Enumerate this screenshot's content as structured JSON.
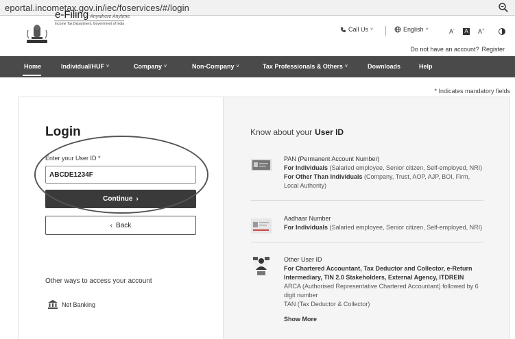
{
  "browser": {
    "url": "eportal.incometax.gov.in/iec/foservices/#/login",
    "zoom_icon": "zoom-icon"
  },
  "header": {
    "logo_title": "e-Filing",
    "logo_tagline": "Anywhere Anytime",
    "logo_subtitle": "Income Tax Department, Government of India",
    "call_us": "Call Us",
    "language": "English",
    "font_decrease": "A",
    "font_normal": "A",
    "font_increase": "A",
    "no_account_text": "Do not have an account?",
    "register": "Register"
  },
  "nav": {
    "items": [
      {
        "label": "Home"
      },
      {
        "label": "Individual/HUF"
      },
      {
        "label": "Company"
      },
      {
        "label": "Non-Company"
      },
      {
        "label": "Tax Professionals & Others"
      },
      {
        "label": "Downloads"
      },
      {
        "label": "Help"
      }
    ]
  },
  "mandatory_note": "* Indicates mandatory fields",
  "login": {
    "title": "Login",
    "field_label": "Enter your User ID *",
    "user_id_value": "ABCDE1234F",
    "continue": "Continue",
    "back": "Back",
    "other_ways": "Other ways to access your account",
    "net_banking": "Net Banking"
  },
  "know_panel": {
    "title_prefix": "Know about your",
    "title_bold": "User ID",
    "pan": {
      "head": "PAN (Permanent Account Number)",
      "ind_label": "For Individuals",
      "ind_text": " (Salaried employee, Senior citizen, Self-employed, NRI)",
      "other_label": "For Other Than Individuals",
      "other_text": " (Company, Trust, AOP, AJP, BOI, Firm, Local Authority)"
    },
    "aadhaar": {
      "head": "Aadhaar Number",
      "ind_label": "For Individuals",
      "ind_text": " (Salaried employee, Senior citizen, Self-employed, NRI)"
    },
    "other": {
      "head": "Other User ID",
      "bold_text": "For Chartered Accountant, Tax Deductor and Collector, e-Return Intermediary, TIN 2.0 Stakeholders, External Agency, ITDREIN",
      "arca": "ARCA (Authorised Representative Chartered Accountant) followed by 6 digit number",
      "tan": "TAN (Tax Deductor & Collector)"
    },
    "show_more": "Show More"
  }
}
